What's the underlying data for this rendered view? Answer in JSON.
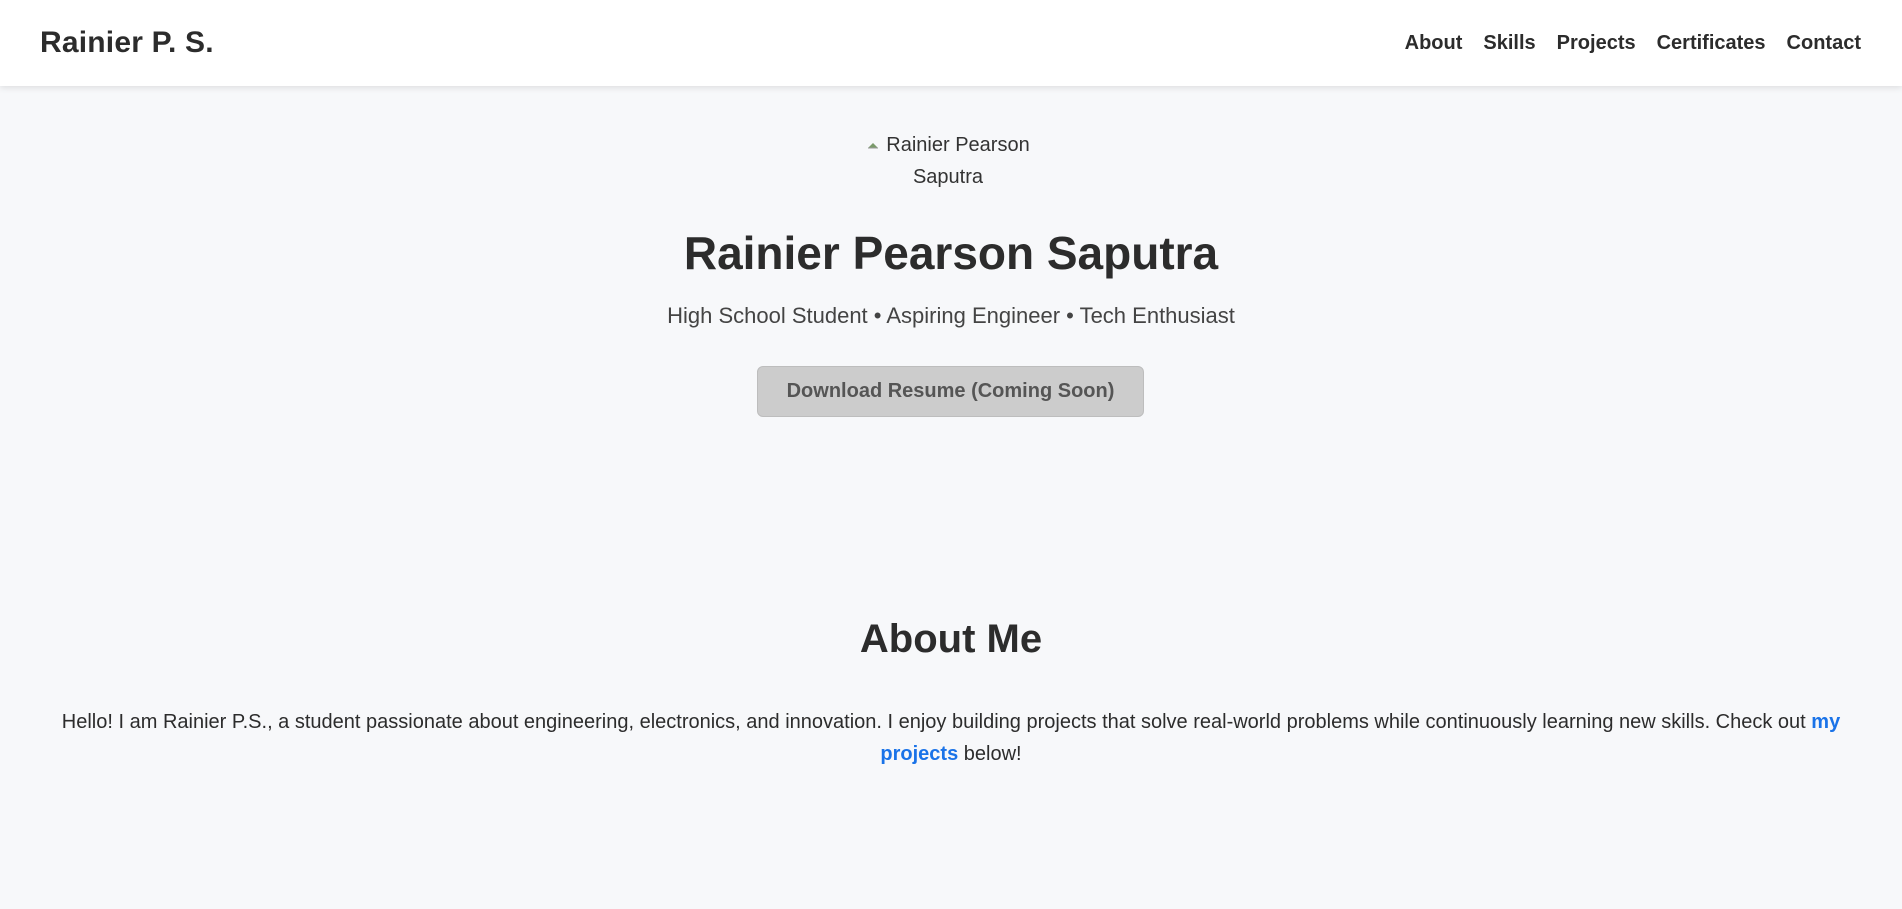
{
  "header": {
    "brand": "Rainier P. S.",
    "nav": [
      {
        "label": "About"
      },
      {
        "label": "Skills"
      },
      {
        "label": "Projects"
      },
      {
        "label": "Certificates"
      },
      {
        "label": "Contact"
      }
    ]
  },
  "hero": {
    "avatar_alt": "Rainier Pearson Saputra",
    "name": "Rainier Pearson Saputra",
    "tagline": "High School Student • Aspiring Engineer • Tech Enthusiast",
    "resume_button": "Download Resume (Coming Soon)"
  },
  "about": {
    "title": "About Me",
    "text_before": "Hello! I am Rainier P.S., a student passionate about engineering, electronics, and innovation. I enjoy building projects that solve real-world problems while continuously learning new skills. Check out ",
    "link_text": "my projects",
    "text_after": " below!"
  },
  "colors": {
    "page_bg": "#f7f8fa",
    "text": "#2c2c2c",
    "link": "#1a73e8",
    "button_bg": "#cccccc"
  }
}
